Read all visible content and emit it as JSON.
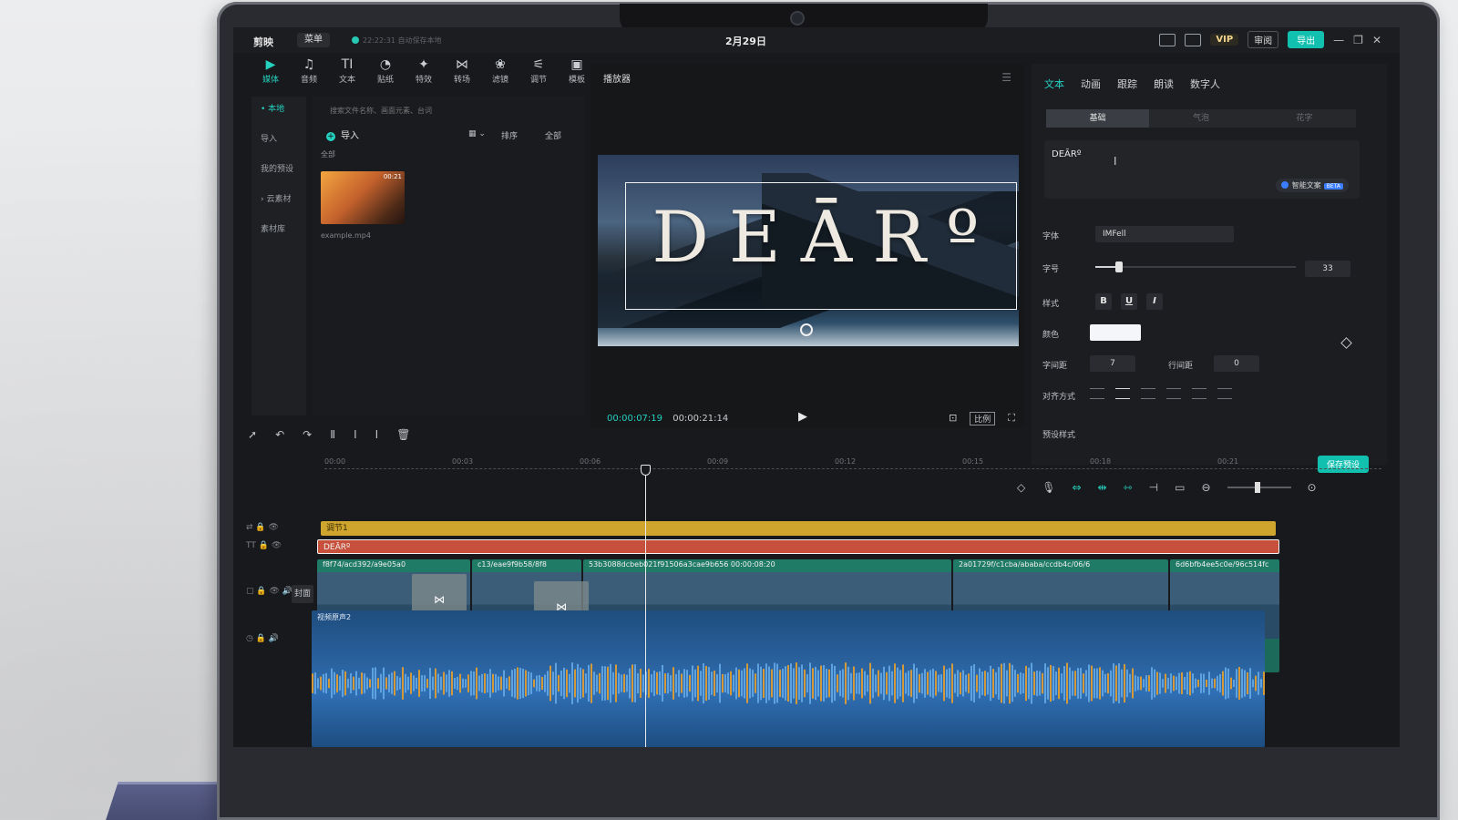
{
  "topbar": {
    "logo": "剪映",
    "menu": "菜单",
    "autosave": "22:22:31 自动保存本地",
    "date": "2月29日",
    "vip": "VIP",
    "share": "审阅",
    "export": "导出"
  },
  "tool_tabs": [
    {
      "icon": "▶",
      "label": "媒体"
    },
    {
      "icon": "♫",
      "label": "音频"
    },
    {
      "icon": "TI",
      "label": "文本"
    },
    {
      "icon": "◔",
      "label": "贴纸"
    },
    {
      "icon": "✦",
      "label": "特效"
    },
    {
      "icon": "⋈",
      "label": "转场"
    },
    {
      "icon": "❀",
      "label": "滤镜"
    },
    {
      "icon": "⚟",
      "label": "调节"
    },
    {
      "icon": "▣",
      "label": "模板"
    }
  ],
  "left_nav": [
    "• 本地",
    "导入",
    "我的预设",
    "› 云素材",
    "素材库"
  ],
  "media": {
    "search_placeholder": "搜索文件名称、画面元素、台词",
    "import_label": "导入",
    "sort": "排序",
    "filter": "全部",
    "all": "全部",
    "clip_name": "example.mp4",
    "clip_duration": "00:21"
  },
  "player": {
    "title": "播放器",
    "overlay_text": "DEĀRº",
    "current_time": "00:00:07:19",
    "total_time": "00:00:21:14",
    "ratio": "比例"
  },
  "right_panel": {
    "tabs": [
      "文本",
      "动画",
      "跟踪",
      "朗读",
      "数字人"
    ],
    "subtabs": [
      "基础",
      "气泡",
      "花字"
    ],
    "text_value": "DEĀRº",
    "ai_button": "智能文案",
    "beta": "BETA",
    "font_label": "字体",
    "font_value": "IMFell",
    "size_label": "字号",
    "size_value": "33",
    "size_fraction": 0.12,
    "style_label": "样式",
    "style_buttons": [
      "B",
      "U",
      "I"
    ],
    "color_label": "颜色",
    "color_value": "#f4f6fa",
    "char_spacing_label": "字间距",
    "char_spacing_value": "7",
    "line_spacing_label": "行间距",
    "line_spacing_value": "0",
    "align_label": "对齐方式",
    "preset_label": "预设样式",
    "save_preset": "保存预设"
  },
  "timeline": {
    "ruler": [
      "00:00",
      "00:03",
      "00:06",
      "00:09",
      "00:12",
      "00:15",
      "00:18",
      "00:21"
    ],
    "adjust_clip": "调节1",
    "text_clip": "DEĀRº",
    "cover_label": "封面",
    "video_clips": [
      "f8f74/acd392/a9e05a0",
      "c13/eae9f9b58/8f8",
      "53b3088dcbeb021f91506a3cae9b656  00:00:08:20",
      "2a01729f/c1cba/ababa/ccdb4c/06/6",
      "6d6bfb4ee5c0e/96c514fc"
    ],
    "audio_clip": "视频原声2"
  },
  "colors": {
    "accent": "#25d0bf",
    "adjust_track": "#cfa52d",
    "text_track": "#c6503b",
    "video_track": "#1f7a66",
    "audio_track": "#2a63a0"
  }
}
